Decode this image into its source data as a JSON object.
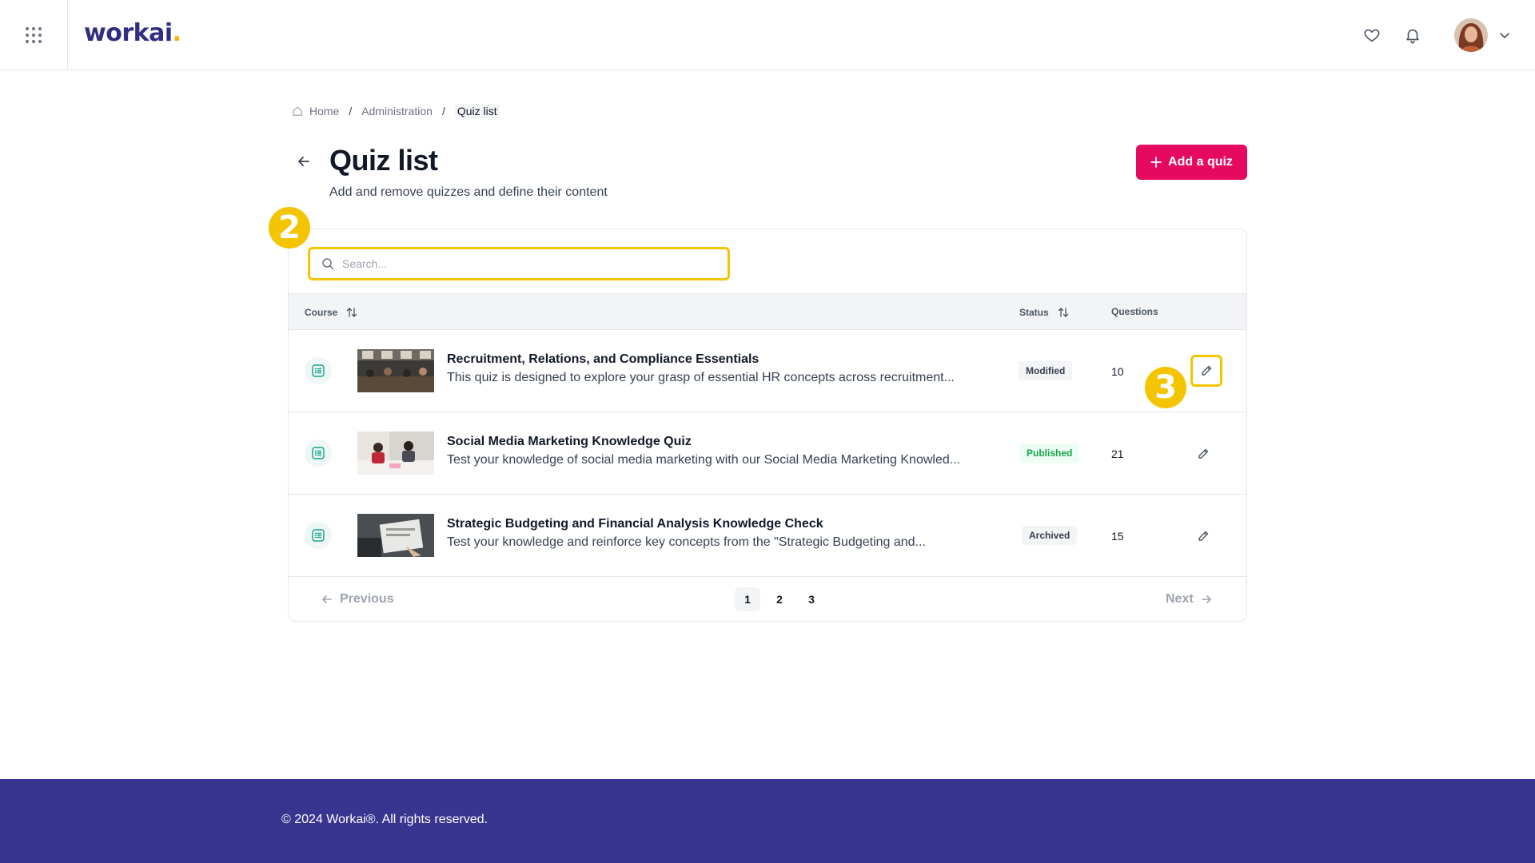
{
  "header": {
    "logo_text": "workai",
    "logo_dot": "."
  },
  "breadcrumb": {
    "items": [
      "Home",
      "Administration",
      "Quiz list"
    ],
    "separator": "/"
  },
  "page": {
    "title": "Quiz list",
    "subtitle": "Add and remove quizzes and define their content",
    "add_button": "Add a quiz"
  },
  "search": {
    "placeholder": "Search...",
    "value": ""
  },
  "table": {
    "columns": {
      "course": "Course",
      "status": "Status",
      "questions": "Questions"
    },
    "rows": [
      {
        "title": "Recruitment, Relations, and Compliance Essentials",
        "description": "This quiz is designed to explore your grasp of essential HR concepts across recruitment...",
        "status": "Modified",
        "questions": "10"
      },
      {
        "title": "Social Media Marketing Knowledge Quiz",
        "description": "Test your knowledge of social media marketing with our Social Media Marketing Knowled...",
        "status": "Published",
        "questions": "21"
      },
      {
        "title": "Strategic Budgeting and Financial Analysis Knowledge Check",
        "description": "Test your knowledge and reinforce key concepts from the \"Strategic Budgeting and...",
        "status": "Archived",
        "questions": "15"
      }
    ]
  },
  "pagination": {
    "previous": "Previous",
    "next": "Next",
    "pages": [
      "1",
      "2",
      "3"
    ]
  },
  "markers": {
    "search_step": "2",
    "edit_step": "3"
  },
  "footer": {
    "copyright": "© 2024 Workai®. All rights reserved."
  },
  "colors": {
    "brand_primary": "#e5095f",
    "brand_navy": "#383591",
    "highlight": "#f5c400",
    "published_green": "#16a34a"
  },
  "icons": [
    "grid-icon",
    "heart-icon",
    "bell-icon",
    "chevron-down-icon",
    "home-icon",
    "arrow-left-icon",
    "plus-icon",
    "search-icon",
    "sort-icon",
    "quiz-list-icon",
    "pencil-icon",
    "arrow-right-icon"
  ]
}
